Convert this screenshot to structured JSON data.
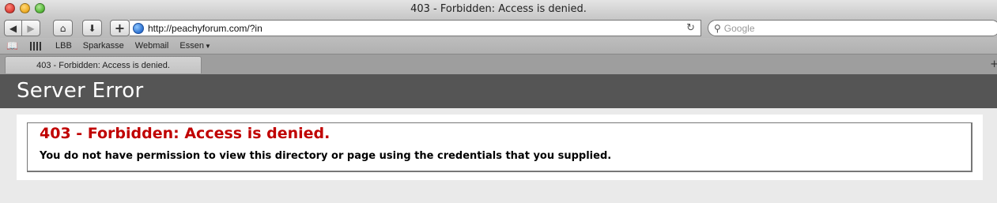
{
  "window": {
    "title": "403 - Forbidden: Access is denied."
  },
  "toolbar": {
    "back_icon": "◀",
    "forward_icon": "▶",
    "home_icon": "⌂",
    "download_icon": "⬇",
    "add_icon": "+",
    "url": "http://peachyforum.com/?in",
    "reload_icon": "↻",
    "search_icon": "⚲",
    "search_placeholder": "Google"
  },
  "bookmarks": {
    "book_icon": "📖",
    "items": [
      "LBB",
      "Sparkasse",
      "Webmail",
      "Essen"
    ],
    "dropdown_icon": "▼"
  },
  "tabs": [
    {
      "label": "403 - Forbidden: Access is denied."
    }
  ],
  "new_tab_icon": "+",
  "page": {
    "header": "Server Error",
    "error_title": "403 - Forbidden: Access is denied.",
    "error_message": "You do not have permission to view this directory or page using the credentials that you supplied."
  }
}
